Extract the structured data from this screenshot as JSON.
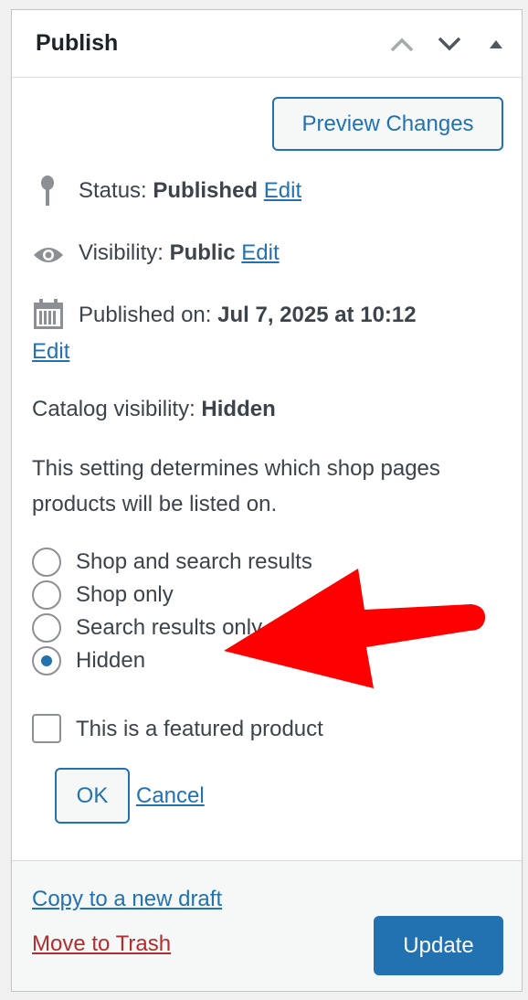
{
  "header": {
    "title": "Publish",
    "icons": [
      "chevron-up-icon",
      "chevron-down-icon",
      "triangle-up-icon"
    ]
  },
  "preview_label": "Preview Changes",
  "status": {
    "label": "Status:",
    "value": "Published",
    "edit": "Edit"
  },
  "visibility": {
    "label": "Visibility:",
    "value": "Public",
    "edit": "Edit"
  },
  "published_on": {
    "label": "Published on:",
    "value": "Jul 7, 2025 at 10:12",
    "edit": "Edit"
  },
  "catalog": {
    "label": "Catalog visibility:",
    "value": "Hidden",
    "description_line1": "This setting determines which shop pages",
    "description_line2": "products will be listed on.",
    "options": [
      {
        "label": "Shop and search results",
        "checked": false
      },
      {
        "label": "Shop only",
        "checked": false
      },
      {
        "label": "Search results only",
        "checked": false
      },
      {
        "label": "Hidden",
        "checked": true
      }
    ],
    "featured_label": "This is a featured product",
    "featured_checked": false,
    "ok_label": "OK",
    "cancel_label": "Cancel"
  },
  "footer": {
    "copy_label": "Copy to a new draft",
    "trash_label": "Move to Trash",
    "update_label": "Update"
  },
  "colors": {
    "accent": "#2271b1",
    "danger": "#b32d2e",
    "annotation_arrow": "#ff0000"
  }
}
